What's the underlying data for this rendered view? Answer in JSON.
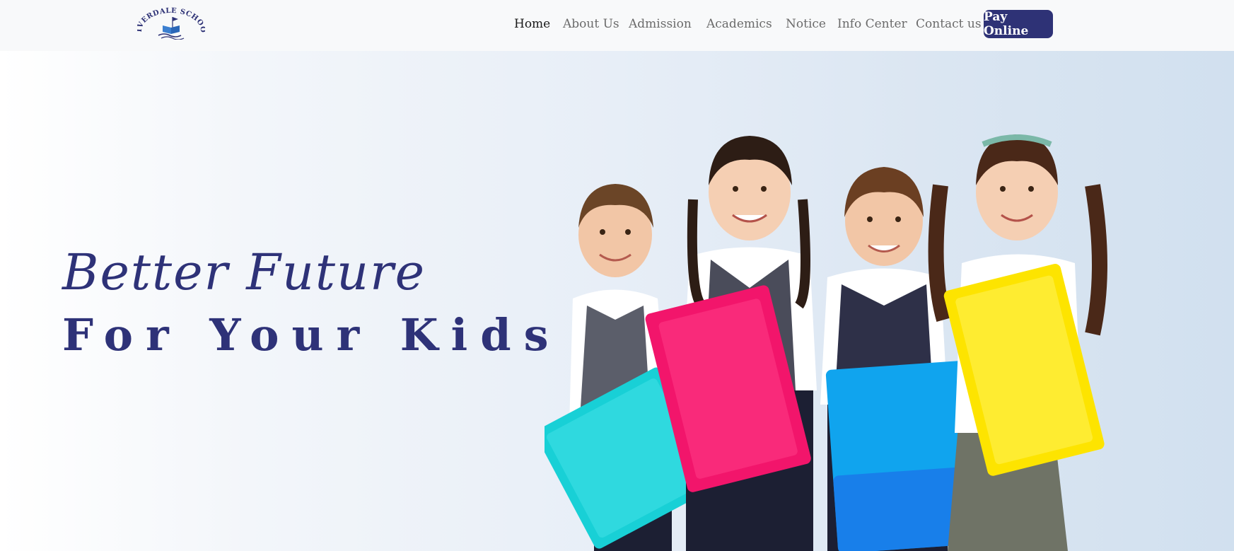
{
  "logo": {
    "text": "RIVERDALE SCHOOL"
  },
  "nav": {
    "items": [
      {
        "label": "Home",
        "active": true
      },
      {
        "label": "About Us",
        "active": false
      },
      {
        "label": "Admission",
        "active": false
      },
      {
        "label": "Academics",
        "active": false
      },
      {
        "label": "Notice",
        "active": false
      },
      {
        "label": "Info Center",
        "active": false
      },
      {
        "label": "Contact us",
        "active": false
      }
    ],
    "pay_button": "Pay Online"
  },
  "hero": {
    "headline_line1": "Better Future",
    "headline_line2": "For Your Kids"
  },
  "colors": {
    "brand_navy": "#2e3276",
    "folder_cyan": "#18d0d6",
    "folder_pink": "#f2156b",
    "folder_blue": "#10a4ee",
    "folder_yellow": "#fde400"
  }
}
